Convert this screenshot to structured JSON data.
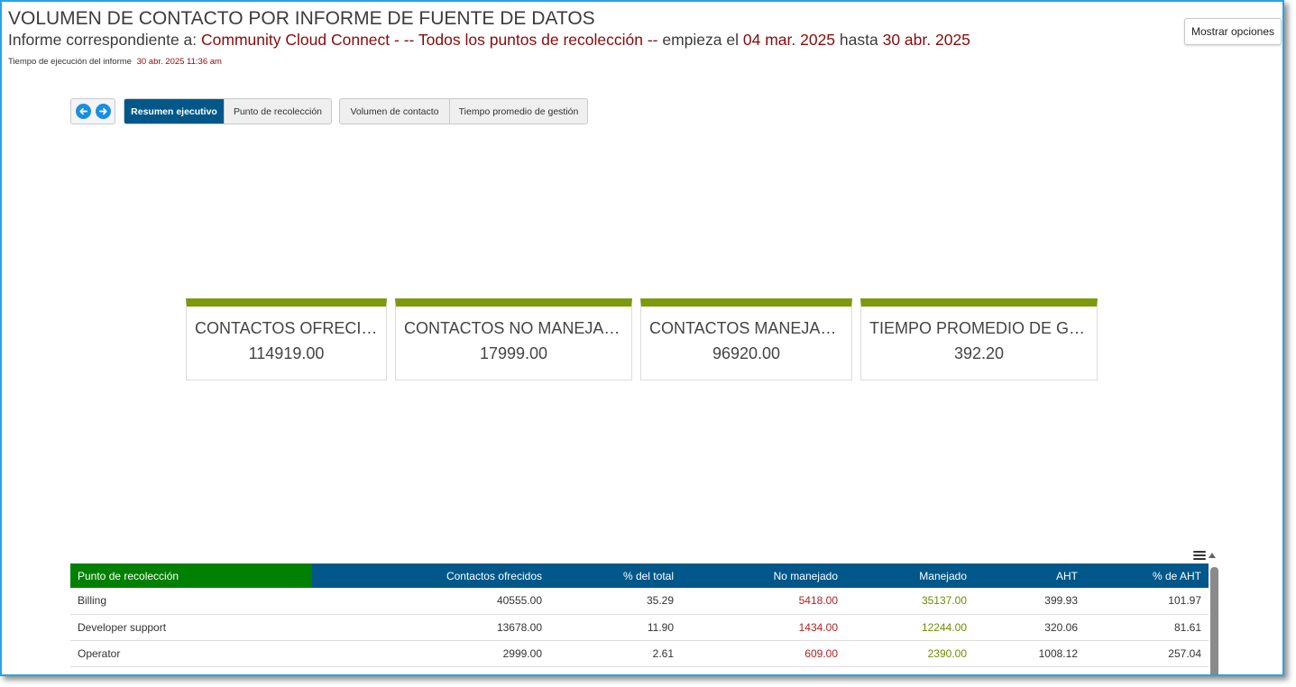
{
  "header": {
    "title": "VOLUMEN DE CONTACTO POR INFORME DE FUENTE DE DATOS",
    "subtitle_prefix": "Informe correspondiente a:",
    "source_name": "Community Cloud Connect",
    "collection_points": " - -- Todos los puntos de recolección --",
    "starts_label": "empieza el",
    "start_date": "04 mar. 2025",
    "until_label": "hasta",
    "end_date": "30 abr. 2025",
    "exec_label": "Tiempo de ejecución del informe",
    "exec_time": "30 abr. 2025 11:36 am"
  },
  "toolbar": {
    "show_options_label": "Mostrar opciones",
    "prev_icon": "arrow-left-circle-icon",
    "next_icon": "arrow-right-circle-icon"
  },
  "tabs_group_1": [
    {
      "label": "Resumen ejecutivo",
      "active": true
    },
    {
      "label": "Punto de recolección",
      "active": false
    }
  ],
  "tabs_group_2": [
    {
      "label": "Volumen de contacto",
      "active": false
    },
    {
      "label": "Tiempo promedio de gestión",
      "active": false
    }
  ],
  "kpis": [
    {
      "label": "CONTACTOS OFRECIDOS",
      "value": "114919.00"
    },
    {
      "label": "CONTACTOS NO MANEJADOS",
      "value": "17999.00"
    },
    {
      "label": "CONTACTOS MANEJADOS",
      "value": "96920.00"
    },
    {
      "label": "TIEMPO PROMEDIO DE GESTIÓN",
      "value": "392.20"
    }
  ],
  "table": {
    "menu_icon": "hamburger-menu-icon",
    "columns": [
      "Punto de recolección",
      "Contactos ofrecidos",
      "% del total",
      "No manejado",
      "Manejado",
      "AHT",
      "% de AHT"
    ],
    "rows": [
      [
        "Billing",
        "40555.00",
        "35.29",
        "5418.00",
        "35137.00",
        "399.93",
        "101.97"
      ],
      [
        "Developer support",
        "13678.00",
        "11.90",
        "1434.00",
        "12244.00",
        "320.06",
        "81.61"
      ],
      [
        "Operator",
        "2999.00",
        "2.61",
        "609.00",
        "2390.00",
        "1008.12",
        "257.04"
      ]
    ]
  },
  "colors": {
    "accent_blue": "#00578a",
    "header_green": "#008000",
    "kpi_bar_green": "#7c9a0a",
    "highlight_red": "#8b0a0a",
    "unhandled_red": "#b22222",
    "handled_green": "#6b8e00"
  }
}
